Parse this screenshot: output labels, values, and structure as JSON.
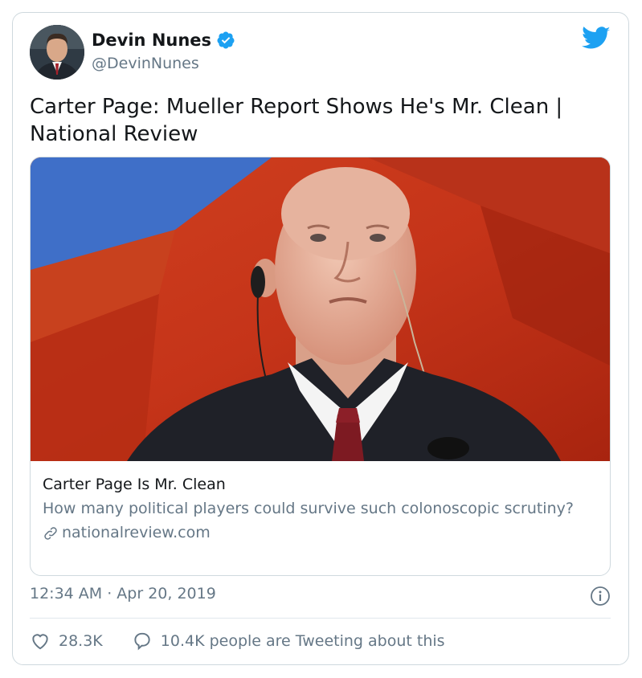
{
  "author": {
    "name": "Devin Nunes",
    "handle": "@DevinNunes",
    "verified": true
  },
  "tweet": {
    "text": "Carter Page: Mueller Report Shows He's Mr. Clean | National Review",
    "timestamp": "12:34 AM · Apr 20, 2019"
  },
  "link_card": {
    "title": "Carter Page Is Mr. Clean",
    "description": "How many political players could survive such colonoscopic scrutiny?",
    "domain": "nationalreview.com"
  },
  "actions": {
    "likes": "28.3K",
    "conversation": "10.4K people are Tweeting about this"
  },
  "icons": {
    "brand": "twitter-bird-icon",
    "verified": "verified-badge-icon",
    "link": "link-icon",
    "info": "info-icon",
    "like": "heart-icon",
    "reply": "speech-bubble-icon"
  },
  "colors": {
    "brand_blue": "#1da1f2",
    "secondary_text": "#657786",
    "border": "#cfd9de"
  }
}
